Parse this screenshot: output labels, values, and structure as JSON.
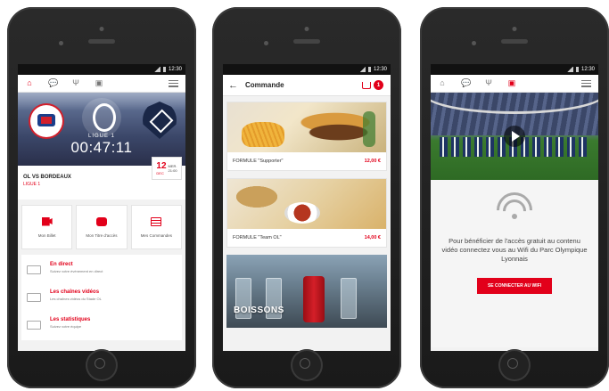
{
  "status": {
    "time": "12:30"
  },
  "phone1": {
    "hero": {
      "league_label": "LIGUE 1",
      "timer": "00:47:11"
    },
    "match": {
      "teams": "OL VS BORDEAUX",
      "league": "LIGUE 1",
      "date": {
        "day": "12",
        "month": "DEC",
        "line1": "MER.",
        "line2": "21:00"
      }
    },
    "tiles": [
      {
        "label": "Mon Billet",
        "icon": "ticket-icon"
      },
      {
        "label": "Mon Titre d'accès",
        "icon": "train-icon"
      },
      {
        "label": "Mes Commandes",
        "icon": "list-icon"
      }
    ],
    "feed": [
      {
        "title": "En direct",
        "sub": "Suivez votre évènement en direct"
      },
      {
        "title": "Les chaînes vidéos",
        "sub": "Les chaînes vidéos du Stade OL"
      },
      {
        "title": "Les statistiques",
        "sub": "Suivez votre équipe"
      }
    ]
  },
  "phone2": {
    "title": "Commande",
    "cart_count": "1",
    "items": [
      {
        "name": "FORMULE \"Supporter\"",
        "price": "12,00 €"
      },
      {
        "name": "FORMULE \"Team OL\"",
        "price": "14,00 €"
      }
    ],
    "drinks_label": "BOISSONS"
  },
  "phone3": {
    "wifi_text": "Pour bénéficier de l'accès gratuit au contenu vidéo connectez vous au Wifi du Parc Olympique Lyonnais",
    "button": "SE CONNECTER AU WIFI"
  },
  "colors": {
    "accent": "#e2001a"
  }
}
